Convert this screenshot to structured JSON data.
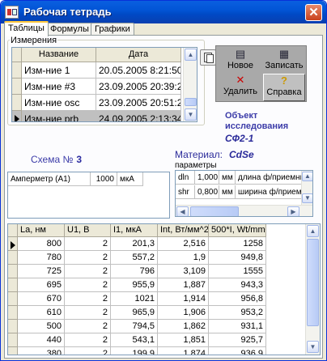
{
  "window": {
    "title": "Рабочая тетрадь",
    "close_glyph": "✕"
  },
  "tabs": [
    "Таблицы",
    "Формулы",
    "Графики"
  ],
  "measurements": {
    "group_label": "Измерения",
    "columns": [
      "Название",
      "Дата"
    ],
    "rows": [
      {
        "name": "Изм-ние 1",
        "date": "20.05.2005 8:21:50"
      },
      {
        "name": "Изм-ние #3",
        "date": "23.09.2005 20:39:25"
      },
      {
        "name": "Изм-ние osc",
        "date": "23.09.2005 20:51:21"
      },
      {
        "name": "Изм-ние prb",
        "date": "24.09.2005 2:13:34"
      }
    ]
  },
  "toolbar": {
    "new_label": "Новое",
    "save_label": "Записать",
    "delete_label": "Удалить",
    "help_label": "Справка"
  },
  "object": {
    "label_line1": "Объект",
    "label_line2": "исследования",
    "name": "СФ2-1"
  },
  "schema": {
    "label": "Схема №",
    "number": "3"
  },
  "material": {
    "label": "Материал:",
    "value": "CdSe",
    "params_label": "параметры"
  },
  "instruments": [
    {
      "name": "Амперметр (А1)",
      "value": "1000",
      "unit": "мкА"
    }
  ],
  "parameters": [
    {
      "key": "dln",
      "value": "1,000",
      "unit": "мм",
      "desc": "длина ф/приемника"
    },
    {
      "key": "shr",
      "value": "0,800",
      "unit": "мм",
      "desc": "ширина ф/приемника"
    }
  ],
  "data_table": {
    "columns": [
      "La, нм",
      "U1, В",
      "I1, мкА",
      "Int, Вт/мм^2",
      "500*I, Wt/mm^2"
    ],
    "rows": [
      [
        "800",
        "2",
        "201,3",
        "2,516",
        "1258"
      ],
      [
        "780",
        "2",
        "557,2",
        "1,9",
        "949,8"
      ],
      [
        "725",
        "2",
        "796",
        "3,109",
        "1555"
      ],
      [
        "695",
        "2",
        "955,9",
        "1,887",
        "943,3"
      ],
      [
        "670",
        "2",
        "1021",
        "1,914",
        "956,8"
      ],
      [
        "610",
        "2",
        "965,9",
        "1,906",
        "953,2"
      ],
      [
        "500",
        "2",
        "794,5",
        "1,862",
        "931,1"
      ],
      [
        "440",
        "2",
        "543,1",
        "1,851",
        "925,7"
      ],
      [
        "380",
        "2",
        "199,9",
        "1,874",
        "936,9"
      ]
    ]
  },
  "scroll_glyphs": {
    "up": "▲",
    "down": "▼",
    "left": "◀",
    "right": "▶"
  },
  "colors": {
    "titlebar": "#0255d6",
    "accent_text": "#2b2b9a",
    "selected_row": "#c0c0c0"
  }
}
